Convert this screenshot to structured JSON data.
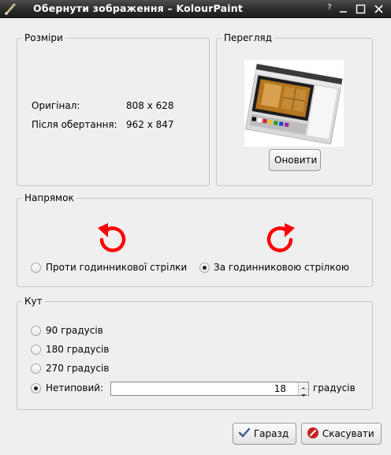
{
  "window": {
    "title": "Обернути зображення – KolourPaint",
    "help_label": "?"
  },
  "sizes": {
    "group_title": "Розміри",
    "original_label": "Оригінал:",
    "original_value": "808 x 628",
    "after_label": "Після обертання:",
    "after_value": "962 x 847"
  },
  "preview": {
    "group_title": "Перегляд",
    "refresh_button": "Оновити"
  },
  "direction": {
    "group_title": "Напрямок",
    "ccw_label": "Проти годинникової стрілки",
    "cw_label": "За годинниковою стрілкою",
    "selected": "cw"
  },
  "angle": {
    "group_title": "Кут",
    "options": [
      "90 градусів",
      "180 градусів",
      "270 градусів"
    ],
    "custom_label": "Нетиповий:",
    "custom_value": "18",
    "unit_label": "градусів",
    "selected": "custom"
  },
  "buttons": {
    "ok": "Гаразд",
    "cancel": "Скасувати"
  },
  "colors": {
    "arrow": "#ff0000",
    "titlebar": "#2b2b2b"
  }
}
